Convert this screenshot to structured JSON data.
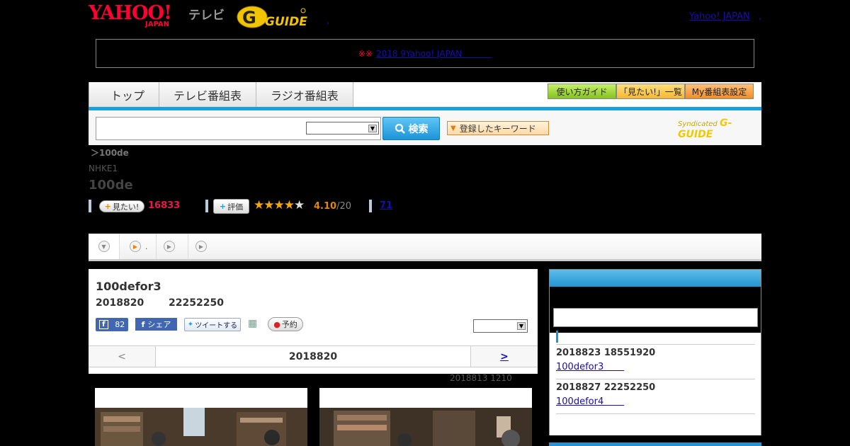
{
  "header": {
    "logo_text": "YAHOO!",
    "logo_sub": "JAPAN",
    "tv_label": "テレビ",
    "gguide_logo": "G-GUIDE",
    "yahoo_link": "Yahoo! JAPAN",
    "sep": ",",
    "stray_dot": ","
  },
  "notice": {
    "mark": "※※",
    "link": "2018 9Yahoo! JAPAN           "
  },
  "nav": {
    "tabs": [
      "トップ",
      "テレビ番組表",
      "ラジオ番組表"
    ],
    "buttons": [
      "使い方ガイド",
      "「見たい!」一覧",
      "My番組表設定"
    ],
    "search_button": "検索",
    "keyword_button": "登録したキーワード",
    "syndicated": "Syndicated",
    "syndicated_logo": "G-GUIDE"
  },
  "program": {
    "breadcrumb": "＞100de",
    "channel": "NHKE1",
    "title": "100de",
    "mitai_label": "見たい!",
    "mitai_count": "16833",
    "hyoka_label": "評価",
    "rating": "4.10",
    "rating_total": "/20",
    "rating_stars": 4,
    "reviews": "71"
  },
  "tabs": {
    "sep": "."
  },
  "episode": {
    "title": "100defor3",
    "date": "2018820",
    "time": "22252250",
    "fb_count": "82",
    "share_label": "シェア",
    "tweet_label": "ツイートする",
    "reserve_label": "予約",
    "pager_prev": "<",
    "pager_current": "2018820",
    "pager_next": ">",
    "updated": "2018813  1210"
  },
  "sidebar": {
    "items": [
      {
        "date": "2018823  18551920",
        "link": "100defor3       "
      },
      {
        "date": "2018827  22252250",
        "link": "100defor4       "
      }
    ]
  },
  "colors": {
    "accent_blue": "#1aa0dc",
    "brand_red": "#ff0033",
    "count_red": "#e6194b",
    "rating_orange": "#e08800"
  }
}
